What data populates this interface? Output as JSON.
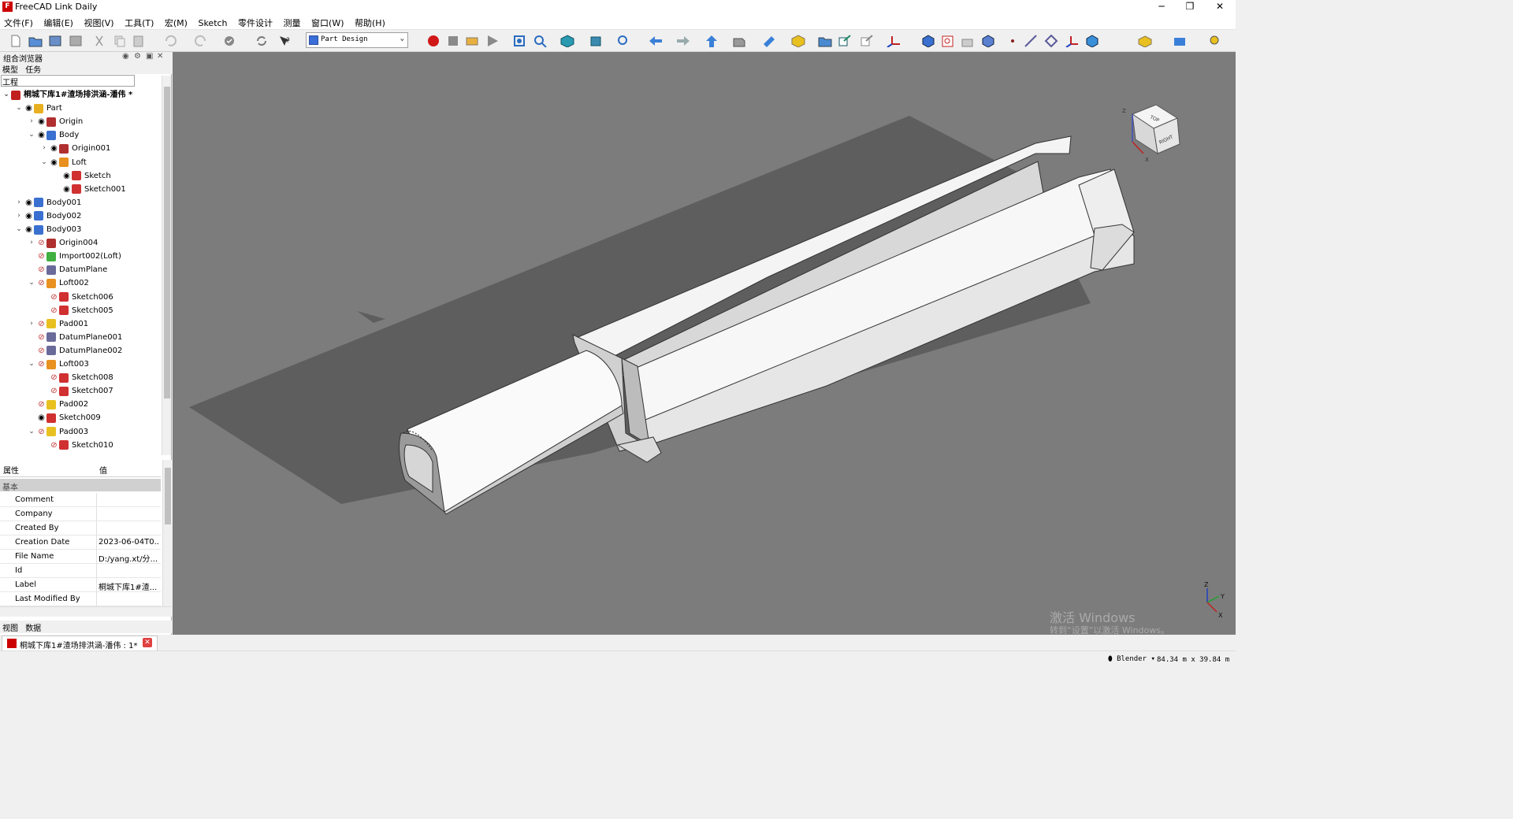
{
  "window": {
    "title": "FreeCAD Link Daily",
    "app_icon": "freecad-icon",
    "minimize": "─",
    "restore": "❐",
    "close": "✕"
  },
  "menu": [
    "文件(F)",
    "编辑(E)",
    "视图(V)",
    "工具(T)",
    "宏(M)",
    "Sketch",
    "零件设计",
    "测量",
    "窗口(W)",
    "帮助(H)"
  ],
  "workbench": {
    "selected": "Part Design"
  },
  "combo_view": {
    "title": "组合浏览器",
    "tabs_top": [
      "模型",
      "任务"
    ],
    "search_value": "工程",
    "tabs_bottom": [
      "视图",
      "数据"
    ]
  },
  "tree": [
    {
      "label": "桐城下库1#渣场排洪涵-潘伟 *",
      "icon": "document-icon"
    },
    {
      "label": "Part",
      "icon": "part-icon"
    },
    {
      "label": "Origin",
      "icon": "origin-icon"
    },
    {
      "label": "Body",
      "icon": "body-icon"
    },
    {
      "label": "Origin001",
      "icon": "origin-icon"
    },
    {
      "label": "Loft",
      "icon": "loft-icon"
    },
    {
      "label": "Sketch",
      "icon": "sketch-icon"
    },
    {
      "label": "Sketch001",
      "icon": "sketch-icon"
    },
    {
      "label": "Body001",
      "icon": "body-icon"
    },
    {
      "label": "Body002",
      "icon": "body-icon"
    },
    {
      "label": "Body003",
      "icon": "body-icon"
    },
    {
      "label": "Origin004",
      "icon": "origin-icon"
    },
    {
      "label": "Import002(Loft)",
      "icon": "import-icon"
    },
    {
      "label": "DatumPlane",
      "icon": "datum-plane-icon"
    },
    {
      "label": "Loft002",
      "icon": "loft-icon"
    },
    {
      "label": "Sketch006",
      "icon": "sketch-icon"
    },
    {
      "label": "Sketch005",
      "icon": "sketch-icon"
    },
    {
      "label": "Pad001",
      "icon": "pad-icon"
    },
    {
      "label": "DatumPlane001",
      "icon": "datum-plane-icon"
    },
    {
      "label": "DatumPlane002",
      "icon": "datum-plane-icon"
    },
    {
      "label": "Loft003",
      "icon": "loft-icon"
    },
    {
      "label": "Sketch008",
      "icon": "sketch-icon"
    },
    {
      "label": "Sketch007",
      "icon": "sketch-icon"
    },
    {
      "label": "Pad002",
      "icon": "pad-icon"
    },
    {
      "label": "Sketch009",
      "icon": "sketch-icon"
    },
    {
      "label": "Pad003",
      "icon": "pad-icon"
    },
    {
      "label": "Sketch010",
      "icon": "sketch-icon"
    }
  ],
  "properties": {
    "col_property": "属性",
    "col_value": "值",
    "group": "基本",
    "rows": [
      {
        "key": "Comment",
        "value": ""
      },
      {
        "key": "Company",
        "value": ""
      },
      {
        "key": "Created By",
        "value": ""
      },
      {
        "key": "Creation Date",
        "value": "2023-06-04T0..."
      },
      {
        "key": "File Name",
        "value": "D:/yang.xt/分..."
      },
      {
        "key": "Id",
        "value": ""
      },
      {
        "key": "Label",
        "value": "桐城下库1#渣..."
      },
      {
        "key": "Last Modified By",
        "value": ""
      }
    ]
  },
  "document_tab": {
    "label": "桐城下库1#渣场排洪涵-潘伟 : 1*",
    "close": "✕"
  },
  "viewport": {
    "background": "#7c7c7c",
    "navcube_faces": [
      "TOP",
      "RIGHT"
    ],
    "navcube_axes": [
      "Z",
      "X"
    ],
    "axis_labels": [
      "Z",
      "Y",
      "X"
    ],
    "watermark_line1": "激活 Windows",
    "watermark_line2": "转到“设置”以激活 Windows。"
  },
  "status": {
    "nav_style": "Blender",
    "dimensions": "84.34 m x 39.84 m"
  }
}
